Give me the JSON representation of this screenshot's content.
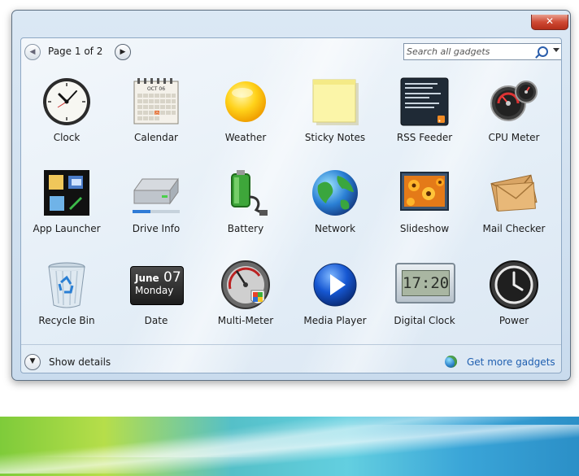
{
  "window": {
    "close_label": ""
  },
  "toolbar": {
    "page_label": "Page 1 of 2",
    "search_placeholder": "Search all gadgets"
  },
  "gadgets": [
    {
      "label": "Clock",
      "icon": "clock-icon"
    },
    {
      "label": "Calendar",
      "icon": "calendar-icon"
    },
    {
      "label": "Weather",
      "icon": "weather-sun-icon"
    },
    {
      "label": "Sticky Notes",
      "icon": "sticky-note-icon"
    },
    {
      "label": "RSS Feeder",
      "icon": "rss-feeder-icon"
    },
    {
      "label": "CPU Meter",
      "icon": "cpu-meter-icon"
    },
    {
      "label": "App Launcher",
      "icon": "app-launcher-icon"
    },
    {
      "label": "Drive Info",
      "icon": "drive-info-icon"
    },
    {
      "label": "Battery",
      "icon": "battery-icon"
    },
    {
      "label": "Network",
      "icon": "globe-icon"
    },
    {
      "label": "Slideshow",
      "icon": "slideshow-icon"
    },
    {
      "label": "Mail Checker",
      "icon": "mail-envelope-icon"
    },
    {
      "label": "Recycle Bin",
      "icon": "recycle-bin-icon"
    },
    {
      "label": "Date",
      "icon": "date-icon"
    },
    {
      "label": "Multi-Meter",
      "icon": "multi-meter-icon"
    },
    {
      "label": "Media Player",
      "icon": "play-button-icon"
    },
    {
      "label": "Digital Clock",
      "icon": "digital-clock-icon"
    },
    {
      "label": "Power",
      "icon": "power-clock-icon"
    }
  ],
  "calendar_icon": {
    "month": "OCT 06",
    "today": "25"
  },
  "date_icon": {
    "month": "June",
    "day": "07",
    "weekday": "Monday"
  },
  "digital_clock_icon": {
    "time": "17:20"
  },
  "footer": {
    "details_label": "Show details",
    "more_gadgets_label": "Get more gadgets"
  },
  "colors": {
    "link": "#1f5fb0",
    "close_button": "#cf4a34"
  }
}
